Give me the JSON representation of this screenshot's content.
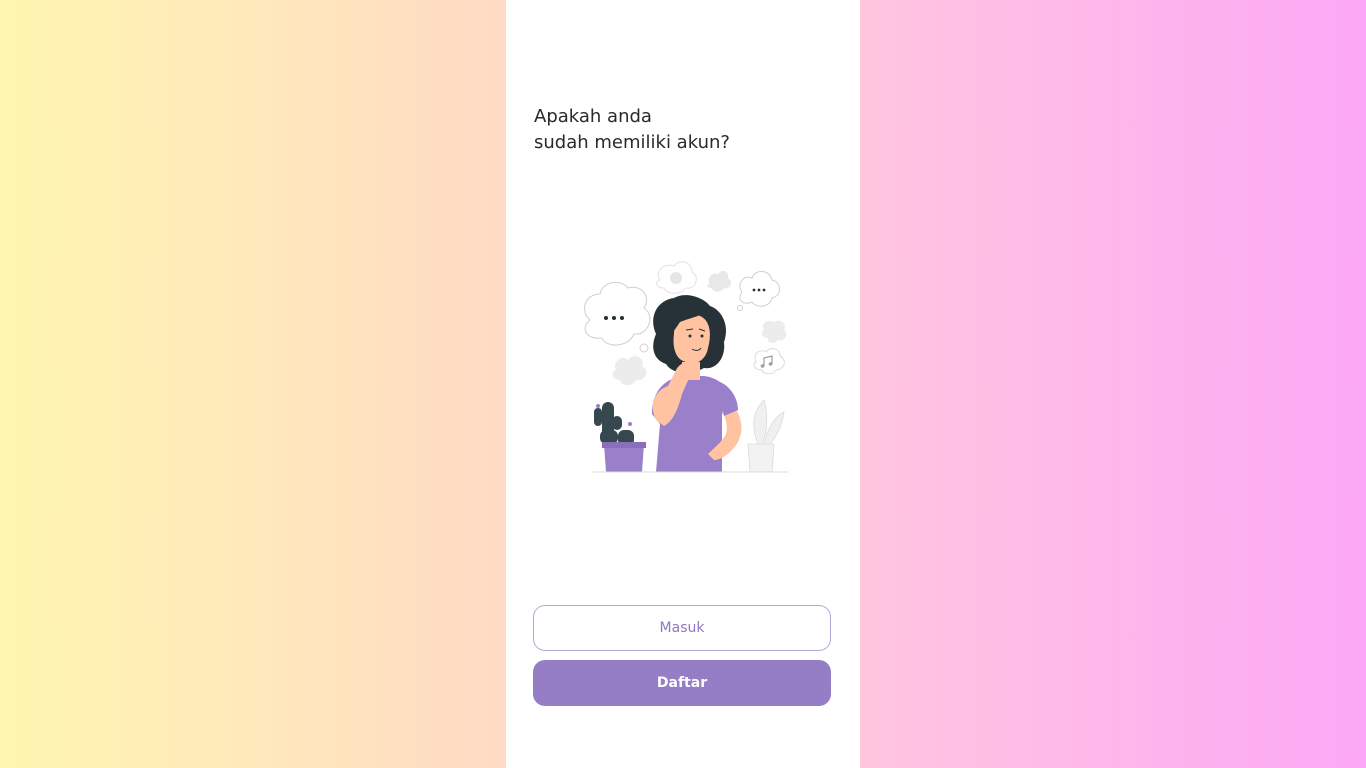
{
  "question": {
    "line1": "Apakah anda",
    "line2": "sudah memiliki akun?"
  },
  "illustration": {
    "icon": "thinking-woman-illustration",
    "accent_color": "#9a7fcb",
    "hair_color": "#263238",
    "plant_color": "#37474f"
  },
  "buttons": {
    "login_label": "Masuk",
    "register_label": "Daftar"
  },
  "colors": {
    "primary": "#957ec5",
    "outline": "#b7a8dc",
    "background_left": "#fff6b0",
    "background_right": "#fca8f6"
  }
}
